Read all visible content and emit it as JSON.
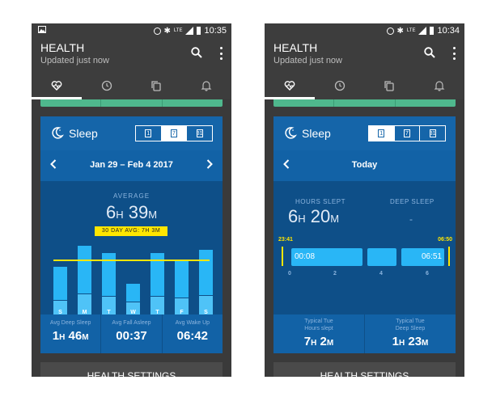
{
  "colors": {
    "phone_bg": "#3a3a3a",
    "card_bg": "#0e4f88",
    "card_header": "#1565a9",
    "accent_yellow": "#ffe600",
    "bar_light": "#4fc3f7",
    "bar_bright": "#29b6f6",
    "green_strip": "#4fb88d"
  },
  "screen1": {
    "status_time": "10:35",
    "app_title": "HEALTH",
    "app_subtitle": "Updated just now",
    "card_title": "Sleep",
    "seg_buttons": [
      "1",
      "7",
      "31"
    ],
    "nav_label": "Jan 29 – Feb 4 2017",
    "average_label": "AVERAGE",
    "avg_h": "6",
    "avg_h_unit": "H",
    "avg_m": "39",
    "avg_m_unit": "M",
    "badge": "30 DAY AVG: 7H 3M",
    "days": [
      "S",
      "M",
      "T",
      "W",
      "T",
      "F",
      "S"
    ],
    "stats": [
      {
        "label": "Avg Deep Sleep",
        "v1": "1",
        "u1": "H",
        "v2": "46",
        "u2": "M"
      },
      {
        "label": "Avg Fall Asleep",
        "value": "00:37"
      },
      {
        "label": "Avg Wake Up",
        "value": "06:42"
      }
    ],
    "settings_label": "HEALTH SETTINGS"
  },
  "screen2": {
    "status_time": "10:34",
    "app_title": "HEALTH",
    "app_subtitle": "Updated just now",
    "card_title": "Sleep",
    "seg_buttons": [
      "1",
      "7",
      "31"
    ],
    "nav_label": "Today",
    "hours_slept_label": "HOURS SLEPT",
    "deep_sleep_label": "DEEP SLEEP",
    "hrs_h": "6",
    "hrs_h_unit": "H",
    "hrs_m": "20",
    "hrs_m_unit": "M",
    "deep_value": "-",
    "start_time": "23:41",
    "end_time": "06:50",
    "block_start": "00:08",
    "block_end": "06:51",
    "ticks": [
      "0",
      "2",
      "4",
      "6"
    ],
    "typ1_label_a": "Typical Tue",
    "typ1_label_b": "Hours slept",
    "typ1_h": "7",
    "typ1_m": "2",
    "typ2_label_a": "Typical Tue",
    "typ2_label_b": "Deep Sleep",
    "typ2_h": "1",
    "typ2_m": "23",
    "unit_h": "H",
    "unit_m": "M",
    "settings_label": "HEALTH SETTINGS"
  },
  "chart_data": {
    "type": "bar",
    "categories": [
      "S",
      "M",
      "T",
      "W",
      "T",
      "F",
      "S"
    ],
    "series": [
      {
        "values": [
          1.2,
          1.5,
          1.0,
          0.6,
          1.0,
          1.2,
          1.3
        ]
      },
      {
        "values": [
          4.8,
          8.2,
          6.6,
          3.4,
          6.6,
          5.7,
          6.7
        ]
      }
    ],
    "average_line": 6.65
  }
}
